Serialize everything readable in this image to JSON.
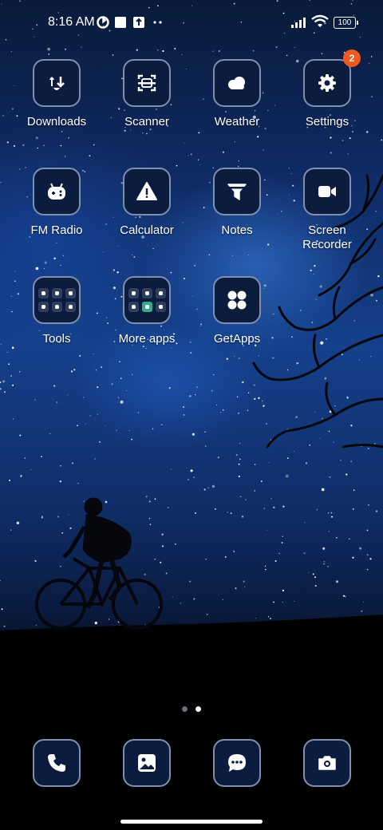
{
  "status_bar": {
    "time": "8:16 AM",
    "battery": "100",
    "icons": [
      "sync-icon",
      "square-notification-icon",
      "upload-icon",
      "more-dots-icon",
      "signal-icon",
      "wifi-icon",
      "battery-icon"
    ]
  },
  "apps": [
    {
      "label": "Downloads",
      "icon": "downloads-icon"
    },
    {
      "label": "Scanner",
      "icon": "scanner-icon"
    },
    {
      "label": "Weather",
      "icon": "weather-icon"
    },
    {
      "label": "Settings",
      "icon": "settings-icon",
      "badge": "2"
    },
    {
      "label": "FM Radio",
      "icon": "fm-radio-icon"
    },
    {
      "label": "Calculator",
      "icon": "calculator-icon"
    },
    {
      "label": "Notes",
      "icon": "notes-icon"
    },
    {
      "label": "Screen\nRecorder",
      "icon": "screen-recorder-icon"
    },
    {
      "label": "Tools",
      "icon": "tools-folder-icon"
    },
    {
      "label": "More apps",
      "icon": "more-apps-folder-icon"
    },
    {
      "label": "GetApps",
      "icon": "getapps-icon"
    }
  ],
  "page_indicator": {
    "pages": 2,
    "current": 2
  },
  "dock": [
    {
      "icon": "phone-icon"
    },
    {
      "icon": "gallery-icon"
    },
    {
      "icon": "messages-icon"
    },
    {
      "icon": "camera-icon"
    }
  ],
  "colors": {
    "badge": "#f0591e",
    "tile_bg": "#0b1c3f",
    "tile_border": "#7f8fae"
  }
}
